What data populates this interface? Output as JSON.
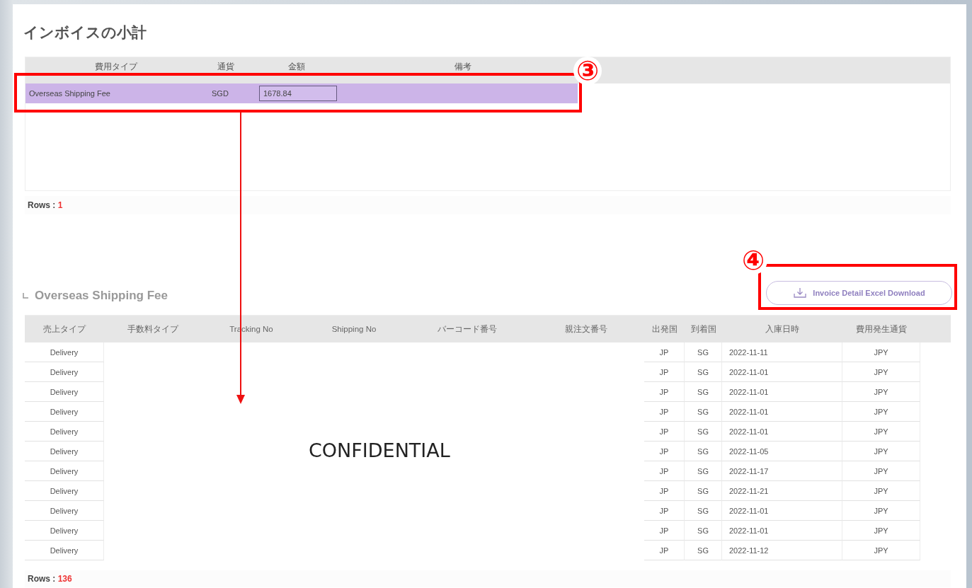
{
  "subtotal": {
    "title": "インボイスの小計",
    "columns": [
      "費用タイプ",
      "通貨",
      "金額",
      "備考"
    ],
    "rows": [
      {
        "fee_type": "Overseas Shipping Fee",
        "currency": "SGD",
        "amount": "1678.84",
        "selected": true
      }
    ],
    "rows_label": "Rows : ",
    "rows_count": "1"
  },
  "detail": {
    "title": "Overseas Shipping Fee",
    "download_button": "Invoice Detail Excel Download",
    "columns": [
      "売上タイプ",
      "手数料タイプ",
      "Tracking No",
      "Shipping No",
      "バーコード番号",
      "親注文番号",
      "出発国",
      "到着国",
      "入庫日時",
      "費用発生通貨"
    ],
    "rows": [
      {
        "sales_type": "Delivery",
        "origin": "JP",
        "destination": "SG",
        "date": "2022-11-11",
        "currency": "JPY"
      },
      {
        "sales_type": "Delivery",
        "origin": "JP",
        "destination": "SG",
        "date": "2022-11-01",
        "currency": "JPY"
      },
      {
        "sales_type": "Delivery",
        "origin": "JP",
        "destination": "SG",
        "date": "2022-11-01",
        "currency": "JPY"
      },
      {
        "sales_type": "Delivery",
        "origin": "JP",
        "destination": "SG",
        "date": "2022-11-01",
        "currency": "JPY"
      },
      {
        "sales_type": "Delivery",
        "origin": "JP",
        "destination": "SG",
        "date": "2022-11-01",
        "currency": "JPY"
      },
      {
        "sales_type": "Delivery",
        "origin": "JP",
        "destination": "SG",
        "date": "2022-11-05",
        "currency": "JPY"
      },
      {
        "sales_type": "Delivery",
        "origin": "JP",
        "destination": "SG",
        "date": "2022-11-17",
        "currency": "JPY"
      },
      {
        "sales_type": "Delivery",
        "origin": "JP",
        "destination": "SG",
        "date": "2022-11-21",
        "currency": "JPY"
      },
      {
        "sales_type": "Delivery",
        "origin": "JP",
        "destination": "SG",
        "date": "2022-11-01",
        "currency": "JPY"
      },
      {
        "sales_type": "Delivery",
        "origin": "JP",
        "destination": "SG",
        "date": "2022-11-01",
        "currency": "JPY"
      },
      {
        "sales_type": "Delivery",
        "origin": "JP",
        "destination": "SG",
        "date": "2022-11-12",
        "currency": "JPY"
      }
    ],
    "rows_label": "Rows : ",
    "rows_count": "136"
  },
  "annotations": {
    "subtotal_marker": "③",
    "download_marker": "④",
    "overlay_text": "CONFIDENTIAL"
  }
}
